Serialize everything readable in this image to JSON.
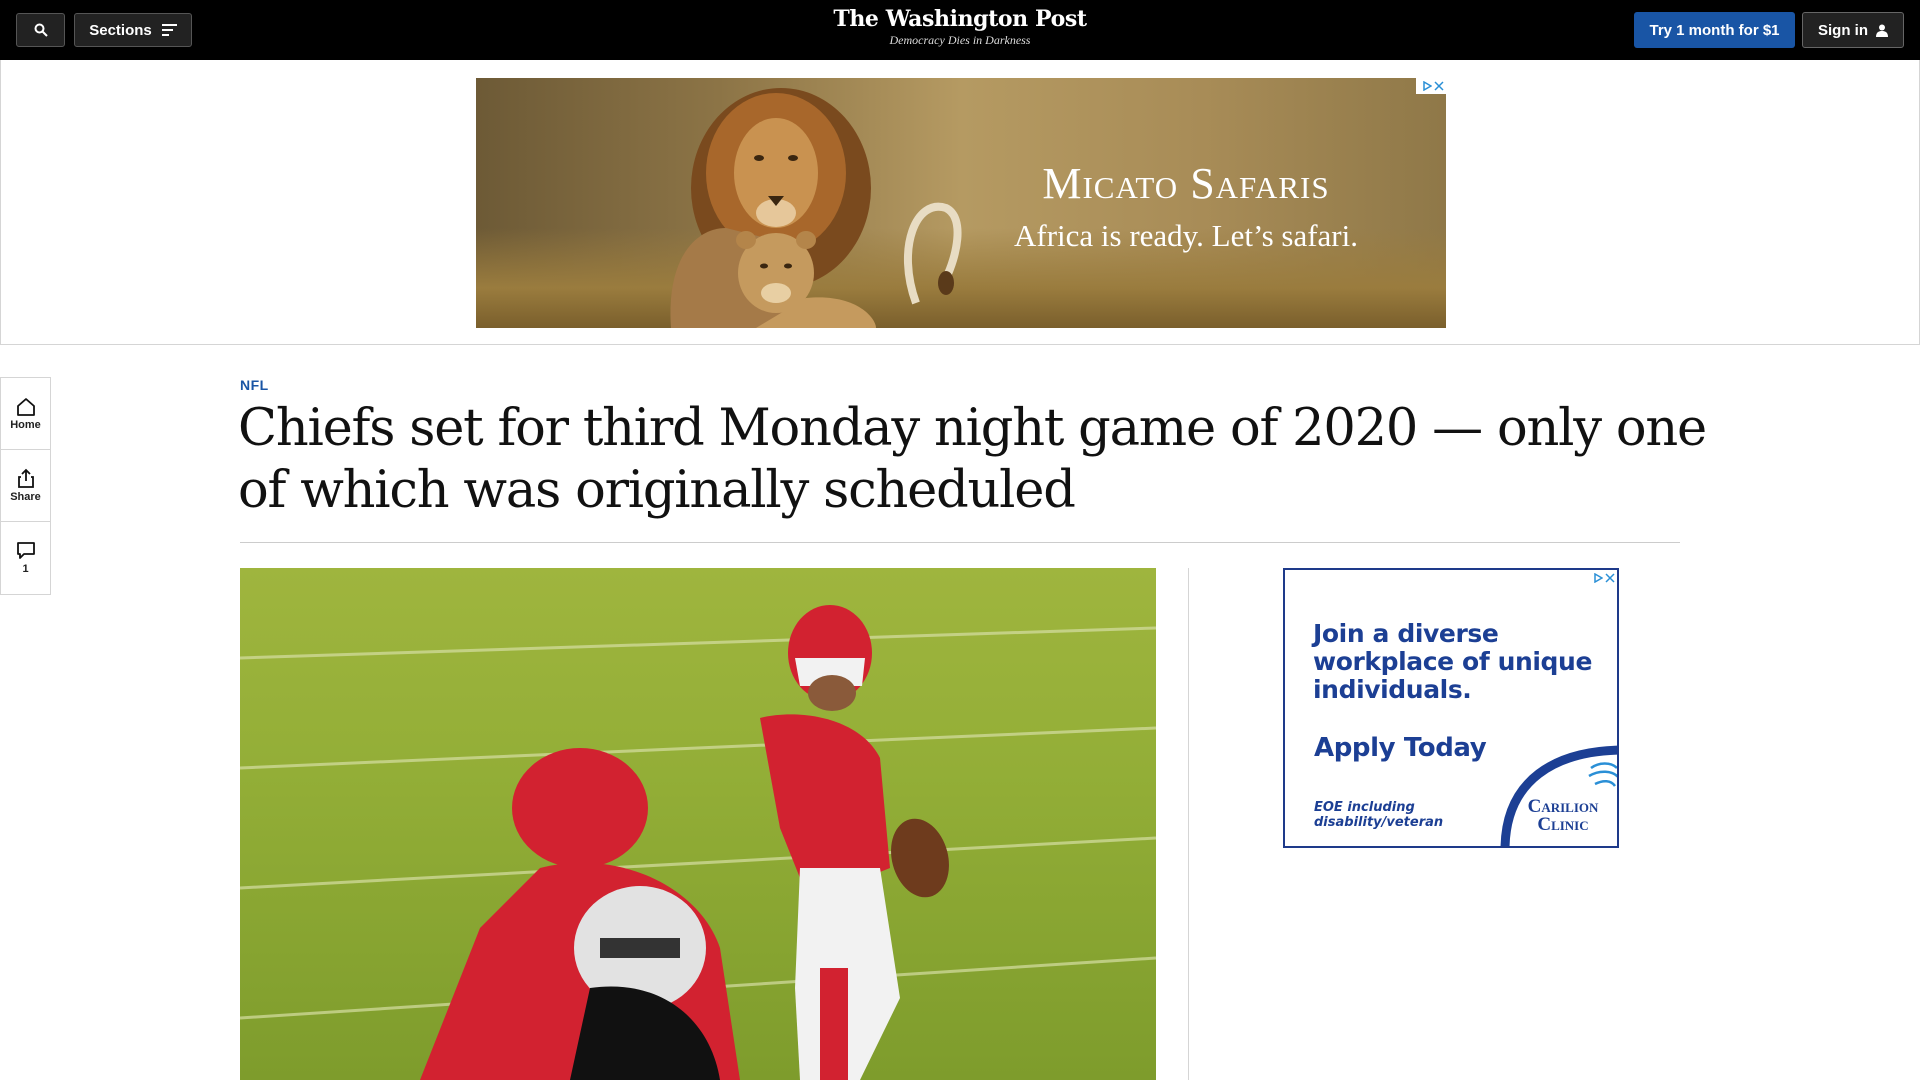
{
  "header": {
    "sections_label": "Sections",
    "logo_text": "The Washington Post",
    "tagline": "Democracy Dies in Darkness",
    "subscribe_label": "Try 1 month for $1",
    "signin_label": "Sign in"
  },
  "top_ad": {
    "title": "Micato Safaris",
    "subtitle": "Africa is ready. Let’s safari."
  },
  "rail": {
    "home_label": "Home",
    "share_label": "Share",
    "comments_count": "1"
  },
  "article": {
    "kicker": "NFL",
    "headline": "Chiefs set for third Monday night game of 2020 — only one of which was originally scheduled"
  },
  "side_ad": {
    "headline": "Join a diverse workplace of unique individuals.",
    "cta": "Apply Today",
    "disclaimer": "EOE including disability/veteran",
    "brand": "Carilion Clinic"
  },
  "colors": {
    "accent_blue": "#1955a5",
    "topbar_bg": "#000000",
    "ad_navy": "#1c3f94"
  }
}
